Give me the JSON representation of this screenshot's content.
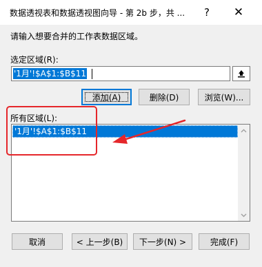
{
  "window": {
    "title": "数据透视表和数据透视图向导 - 第 2b 步，共 ...",
    "help_label": "?",
    "close_label": "✕"
  },
  "instruction": "请输入想要合并的工作表数据区域。",
  "range": {
    "label": "选定区域(R):",
    "value": "'1月'!$A$1:$B$11"
  },
  "actions": {
    "add": "添加(A)",
    "delete": "删除(D)",
    "browse": "浏览(W)..."
  },
  "all_ranges": {
    "label": "所有区域(L):",
    "items": [
      "'1月'!$A$1:$B$11"
    ]
  },
  "footer": {
    "cancel": "取消",
    "back": "< 上一步(B)",
    "next": "下一步(N) >",
    "finish": "完成(F)"
  },
  "colors": {
    "selection": "#0078d7",
    "annotation": "#e5262a",
    "dialog_bg": "#f0f0f0"
  },
  "icons": [
    "collapse-dialog-icon",
    "scroll-up-icon",
    "scroll-down-icon",
    "close-icon",
    "help-icon"
  ]
}
